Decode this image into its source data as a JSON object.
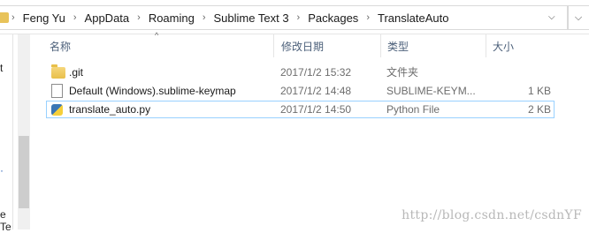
{
  "breadcrumb": [
    "Feng Yu",
    "AppData",
    "Roaming",
    "Sublime Text 3",
    "Packages",
    "TranslateAuto"
  ],
  "separator": "›",
  "dropdown": "⌵",
  "columns": {
    "name": "名称",
    "modified": "修改日期",
    "type": "类型",
    "size": "大小"
  },
  "sort_arrow": "^",
  "files": [
    {
      "name": ".git",
      "modified": "2017/1/2 15:32",
      "type": "文件夹",
      "size": "",
      "icon": "folder-icon"
    },
    {
      "name": "Default (Windows).sublime-keymap",
      "modified": "2017/1/2 14:48",
      "type": "SUBLIME-KEYM...",
      "size": "1 KB",
      "icon": "file-icon"
    },
    {
      "name": "translate_auto.py",
      "modified": "2017/1/2 14:50",
      "type": "Python File",
      "size": "2 KB",
      "icon": "python-file-icon"
    }
  ],
  "left_pane": {
    "frag1": "t",
    "frag2": "e Te"
  },
  "watermark": "http://blog.csdn.net/csdnYF"
}
